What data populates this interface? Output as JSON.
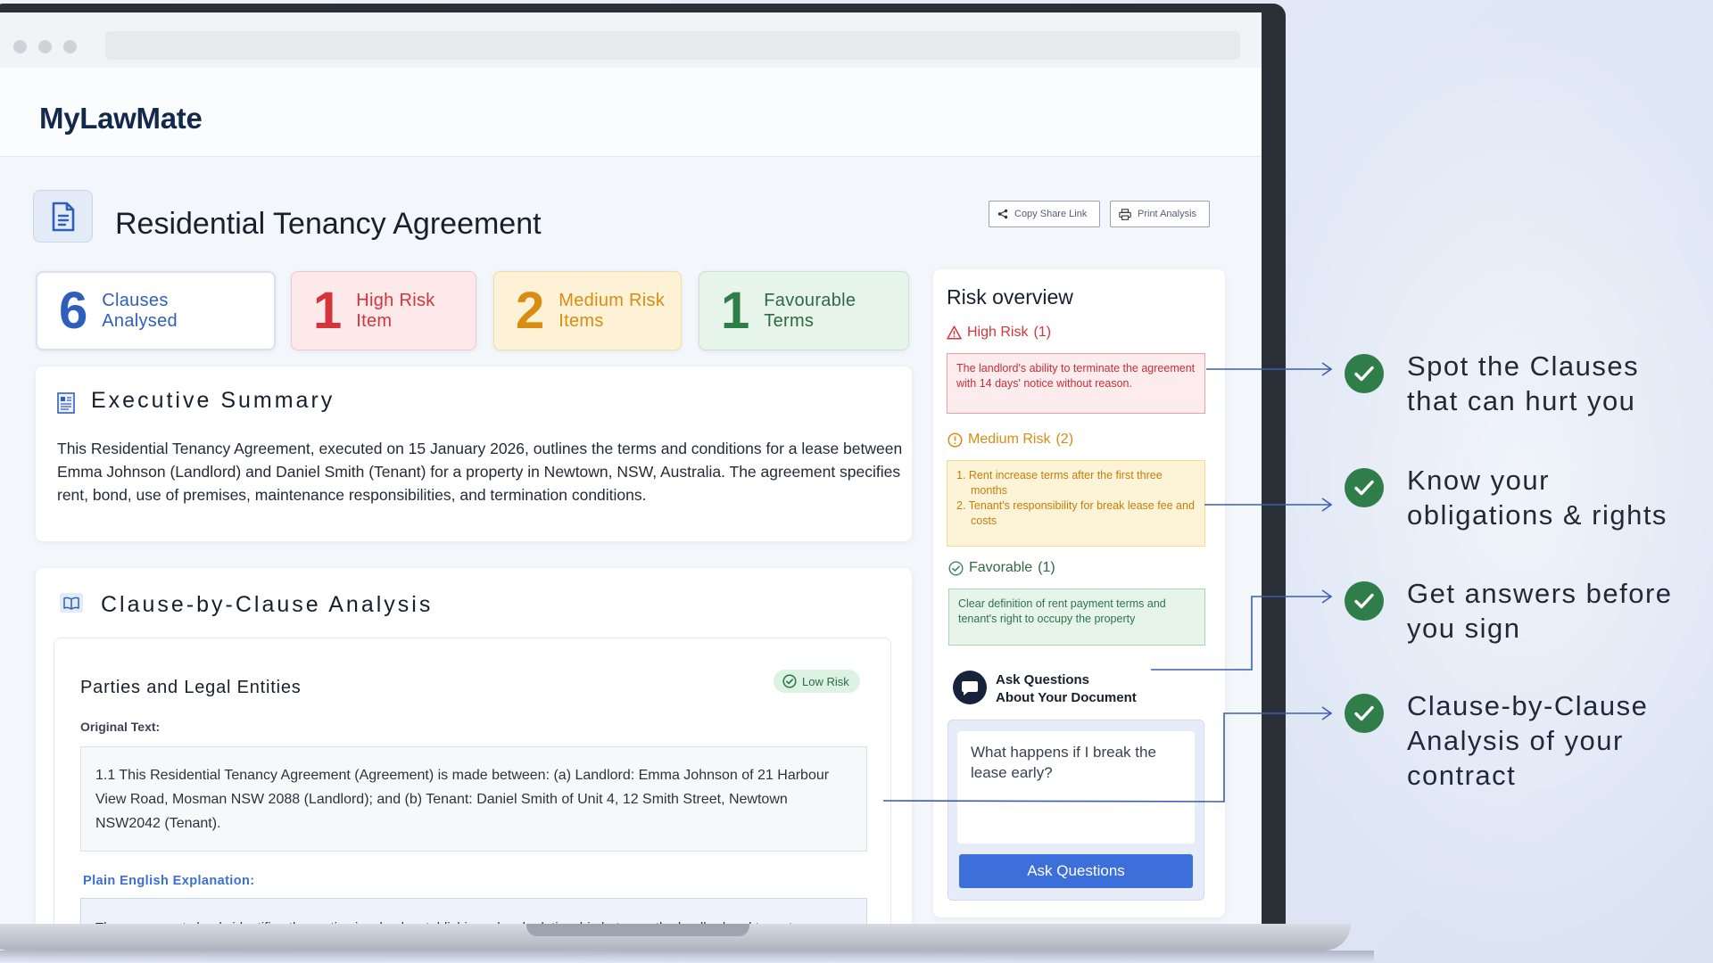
{
  "app": {
    "logo": "MyLawMate"
  },
  "document": {
    "title": "Residential Tenancy Agreement",
    "actions": {
      "copy_share": "Copy Share Link",
      "print": "Print Analysis"
    }
  },
  "stats": [
    {
      "num": "6",
      "label_1": "Clauses",
      "label_2": "Analysed"
    },
    {
      "num": "1",
      "label_1": "High Risk",
      "label_2": "Item"
    },
    {
      "num": "2",
      "label_1": "Medium Risk",
      "label_2": "Items"
    },
    {
      "num": "1",
      "label_1": "Favourable",
      "label_2": "Terms"
    }
  ],
  "summary": {
    "title": "Executive Summary",
    "text": "This Residential Tenancy Agreement, executed on 15 January 2026, outlines the terms and conditions for a lease between Emma Johnson (Landlord) and Daniel Smith (Tenant) for a property in Newtown, NSW, Australia. The agreement specifies rent, bond, use of premises, maintenance responsibilities, and termination conditions."
  },
  "clause_analysis": {
    "title": "Clause-by-Clause Analysis",
    "clause": {
      "title": "Parties and Legal Entities",
      "badge": "Low Risk",
      "original_label": "Original Text:",
      "original_text": "1.1 This Residential Tenancy Agreement (Agreement) is made between: (a) Landlord: Emma Johnson of 21 Harbour View Road, Mosman NSW 2088 (Landlord); and (b) Tenant: Daniel Smith of Unit 4, 12 Smith Street, Newtown NSW2042 (Tenant).",
      "plain_label": "Plain English Explanation:",
      "plain_text": "The agreement clearly identifies the parties involved, establishing a legal relationship between the landlord and tenant."
    }
  },
  "risk_overview": {
    "title": "Risk overview",
    "high": {
      "label": "High Risk",
      "count": "(1)",
      "items": [
        "The landlord's ability to terminate the agreement with 14 days' notice without reason."
      ]
    },
    "medium": {
      "label": "Medium Risk",
      "count": "(2)",
      "items": [
        "1.  Rent increase terms after the first three months",
        "2.  Tenant's responsibility for break lease fee and costs"
      ]
    },
    "favorable": {
      "label": "Favorable",
      "count": "(1)",
      "items": [
        "Clear definition of rent payment terms and tenant's right to occupy the property"
      ]
    },
    "ask": {
      "heading_1": "Ask Questions",
      "heading_2": "About Your Document",
      "question": "What happens if I break the lease early?",
      "button": "Ask Questions"
    }
  },
  "features": [
    {
      "line_1": "Spot the Clauses",
      "line_2": "that can hurt you"
    },
    {
      "line_1": "Know your",
      "line_2": "obligations & rights"
    },
    {
      "line_1": "Get answers before",
      "line_2": "you sign"
    },
    {
      "line_1": "Clause-by-Clause",
      "line_2": "Analysis of your",
      "line_3": "contract"
    }
  ],
  "colors": {
    "high": "#d6343c",
    "medium": "#d98c12",
    "favourable": "#2f7e4a",
    "accent": "#2f5fbd",
    "connector": "#3a5fb0"
  }
}
